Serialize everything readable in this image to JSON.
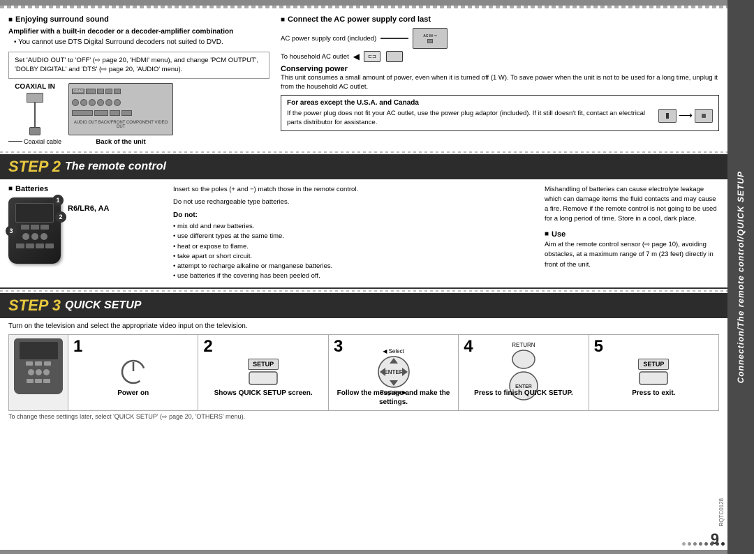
{
  "page": {
    "title": "Connection/The remote control/QUICK SETUP",
    "page_number": "9",
    "product_code": "RQTC0128"
  },
  "sidebar": {
    "text": "Connection/The remote control/QUICK SETUP"
  },
  "top_section": {
    "left_heading": "Enjoying surround sound",
    "amplifier_heading": "Amplifier with a built-in decoder or a decoder-amplifier combination",
    "amplifier_bullet": "You cannot use DTS Digital Surround decoders not suited to DVD.",
    "box_note": "Set 'AUDIO OUT' to 'OFF' (⇨ page 20, 'HDMI' menu), and change 'PCM OUTPUT', 'DOLBY DIGITAL' and 'DTS' (⇨ page 20, 'AUDIO' menu).",
    "coaxial_label": "COAXIAL IN",
    "coaxial_cable_label": "Coaxial cable",
    "back_unit_label": "Back of the unit",
    "right_heading": "Connect the AC power supply cord last",
    "ac_cord_label": "AC power supply cord (included)",
    "household_label": "To household AC outlet",
    "conserving_heading": "Conserving power",
    "conserving_text": "This unit consumes a small amount of power, even when it is turned off (1 W). To save power when the unit is not to be used for a long time, unplug it from the household AC outlet.",
    "areas_heading": "For areas except the U.S.A. and Canada",
    "areas_text": "If the power plug does not fit your AC outlet, use the power plug adaptor (included). If it still doesn't fit, contact an electrical parts distributor for assistance."
  },
  "step2": {
    "step_label": "STEP",
    "step_number": "2",
    "title": "The remote control",
    "batteries_heading": "Batteries",
    "battery_type": "R6/LR6, AA",
    "battery_nums": [
      "1",
      "2",
      "3"
    ],
    "insert_text": "Insert so the poles (+ and −) match those in the remote control.",
    "no_rechargeable": "Do not use rechargeable type batteries.",
    "do_not_heading": "Do not:",
    "do_not_items": [
      "mix old and new batteries.",
      "use different types at the same time.",
      "heat or expose to flame.",
      "take apart or short circuit.",
      "attempt to recharge alkaline or manganese batteries.",
      "use batteries if the covering has been peeled off."
    ],
    "mishandling_text": "Mishandling of batteries can cause electrolyte leakage which can damage items the fluid contacts and may cause a fire. Remove if the remote control is not going to be used for a long period of time. Store in a cool, dark place.",
    "use_heading": "Use",
    "use_text": "Aim at the remote control sensor (⇨ page 10), avoiding obstacles, at a maximum range of 7 m (23 feet) directly in front of the unit."
  },
  "step3": {
    "step_label": "STEP",
    "step_number": "3",
    "title": "QUICK SETUP",
    "instruction": "Turn on the television and select the appropriate video input on the television.",
    "steps": [
      {
        "number": "1",
        "icon": "power-btn",
        "label": "Power on",
        "sublabel": ""
      },
      {
        "number": "2",
        "icon": "setup-btn",
        "label": "Shows QUICK SETUP screen.",
        "sublabel": ""
      },
      {
        "number": "3",
        "icon": "enter-btn",
        "label": "Follow the message and make the settings.",
        "sublabel": "Select / Register"
      },
      {
        "number": "4",
        "icon": "enter-btn-2",
        "label": "Press to finish QUICK SETUP.",
        "sublabel": ""
      },
      {
        "number": "5",
        "icon": "setup-btn-2",
        "label": "Press to exit.",
        "sublabel": ""
      }
    ],
    "bottom_note": "To change these settings later, select 'QUICK SETUP' (⇨ page 20, 'OTHERS' menu).",
    "setup_icon_label": "SETUP",
    "return_icon_label": "RETURN",
    "enter_icon_label": "ENTER"
  }
}
